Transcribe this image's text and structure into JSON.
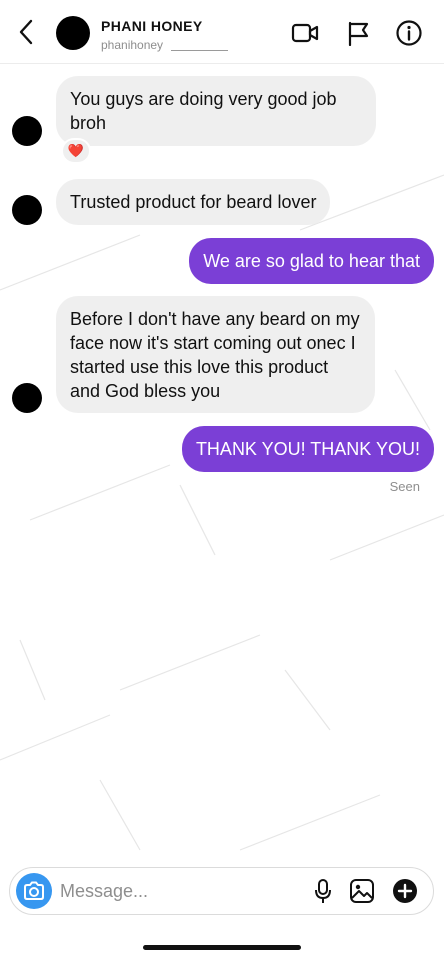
{
  "header": {
    "name": "PHANI HONEY",
    "username": "phanihoney",
    "icons": [
      "back-icon",
      "video-call-icon",
      "flag-icon",
      "info-icon"
    ]
  },
  "messages": [
    {
      "direction": "incoming",
      "text": "You guys are doing very good job broh",
      "reaction": "❤️"
    },
    {
      "direction": "incoming",
      "text": "Trusted product for beard lover"
    },
    {
      "direction": "outgoing",
      "text": "We are so glad to hear that"
    },
    {
      "direction": "incoming",
      "text": "Before I don't have any beard on my face now it's start coming out onec I started use this love this product and God bless you"
    },
    {
      "direction": "outgoing",
      "text": "THANK YOU! THANK YOU!"
    }
  ],
  "status": {
    "seen": "Seen"
  },
  "composer": {
    "placeholder": "Message...",
    "icons": [
      "camera-icon",
      "microphone-icon",
      "gallery-icon",
      "plus-icon"
    ]
  },
  "colors": {
    "outgoing_bubble": "#7b3fd6",
    "incoming_bubble": "#efefef",
    "camera_button": "#3797f0",
    "reaction": "#e0245e"
  }
}
